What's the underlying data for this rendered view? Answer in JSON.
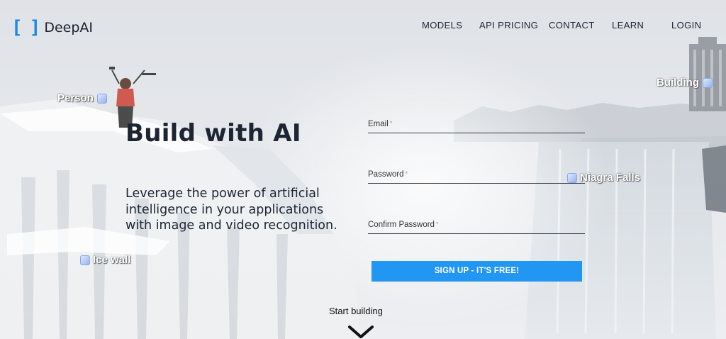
{
  "brand": {
    "name": "DeepAI",
    "accent": "#1e88e5"
  },
  "nav": {
    "models": "MODELS",
    "api_pricing": "API PRICING",
    "contact": "CONTACT",
    "learn": "LEARN",
    "login": "LOGIN"
  },
  "labels": {
    "person": "Person",
    "building": "Building",
    "niagara": "Niagra Falls",
    "ice_wall": "Ice wall"
  },
  "hero": {
    "title": "Build with AI",
    "subtitle": "Leverage the power of artificial intelligence in your applications with image and video recognition."
  },
  "form": {
    "email_label": "Email",
    "password_label": "Password",
    "confirm_label": "Confirm Password",
    "required_mark": "*",
    "email_value": "",
    "password_value": "",
    "confirm_value": "",
    "submit_label": "SIGN UP - IT'S FREE!",
    "submit_color": "#2196f3"
  },
  "footer": {
    "start_label": "Start building",
    "scroll_icon": "chevron-down-icon"
  }
}
